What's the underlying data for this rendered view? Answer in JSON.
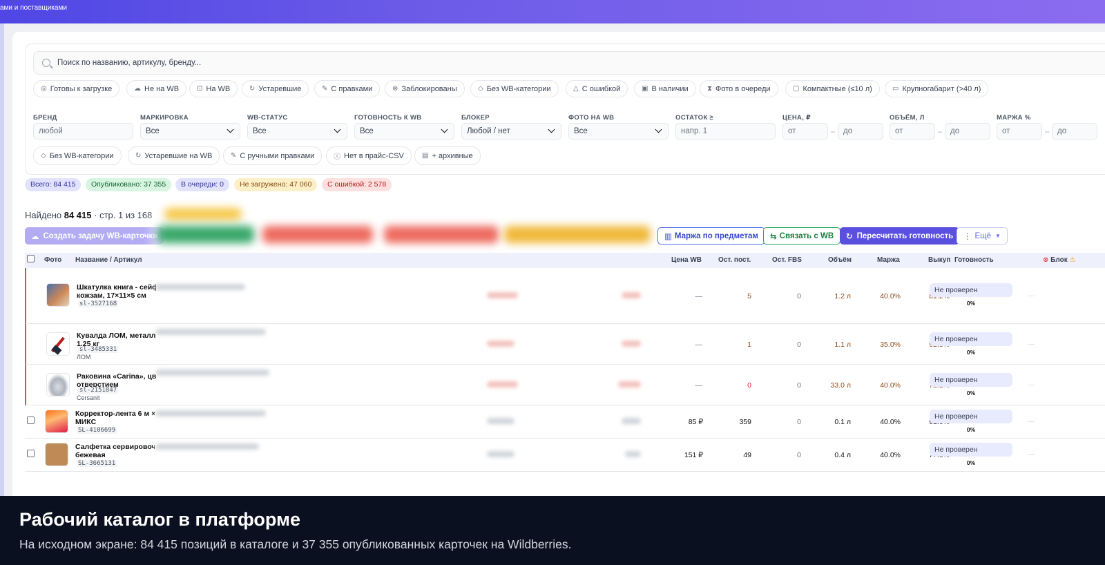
{
  "header": {
    "title_fragment": "ами и поставщиками"
  },
  "search": {
    "placeholder": "Поиск по названию, артикулу, бренду..."
  },
  "quick_filters": [
    {
      "label": "Готовы к загрузке",
      "icon": "check-circle-icon"
    },
    {
      "label": "Не на WB",
      "icon": "cloud-icon"
    },
    {
      "label": "На WB",
      "icon": "bag-icon"
    },
    {
      "label": "Устаревшие",
      "icon": "refresh-icon"
    },
    {
      "label": "С правками",
      "icon": "pin-icon"
    },
    {
      "label": "Заблокированы",
      "icon": "x-circle-icon"
    },
    {
      "label": "Без WB-категории",
      "icon": "tag-icon"
    },
    {
      "label": "С ошибкой",
      "icon": "warning-icon"
    },
    {
      "label": "В наличии",
      "icon": "box-icon"
    },
    {
      "label": "Фото в очереди",
      "icon": "hourglass-icon"
    },
    {
      "label": "Компактные (≤10 л)",
      "icon": "cube-icon"
    },
    {
      "label": "Крупногабарит (>40 л)",
      "icon": "package-icon"
    }
  ],
  "fields": {
    "brand": {
      "label": "БРЕНД",
      "placeholder": "любой"
    },
    "marking": {
      "label": "МАРКИРОВКА",
      "value": "Все"
    },
    "wb_status": {
      "label": "WB-СТАТУС",
      "value": "Все"
    },
    "readiness": {
      "label": "ГОТОВНОСТЬ К WB",
      "value": "Все"
    },
    "blocker": {
      "label": "БЛОКЕР",
      "value": "Любой / нет"
    },
    "photo": {
      "label": "ФОТО НА WB",
      "value": "Все"
    },
    "stock": {
      "label": "ОСТАТОК ≥",
      "placeholder": "напр. 1"
    },
    "price": {
      "label": "ЦЕНА, ₽",
      "from": "от",
      "to": "до"
    },
    "volume": {
      "label": "ОБЪЁМ, Л",
      "from": "от",
      "to": "до"
    },
    "margin": {
      "label": "МАРЖА %",
      "from": "от",
      "to": "до"
    }
  },
  "toggle_filters": [
    {
      "label": "Без WB-категории",
      "icon": "tag-icon"
    },
    {
      "label": "Устаревшие на WB",
      "icon": "refresh-icon"
    },
    {
      "label": "С ручными правками",
      "icon": "pin-icon"
    },
    {
      "label": "Нет в прайс-CSV",
      "icon": "alert-circle-icon"
    },
    {
      "label": "+ архивные",
      "icon": "archive-icon"
    }
  ],
  "stats": {
    "total": "Всего: 84 415",
    "published": "Опубликовано: 37 355",
    "queued": "В очереди: 0",
    "not_loaded": "Не загружено: 47 060",
    "errors": "С ошибкой: 2 578"
  },
  "results": {
    "prefix": "Найдено",
    "count": "84 415",
    "suffix": "· стр. 1 из 168"
  },
  "actions": {
    "create_task": "Создать задачу WB-карточки",
    "margin_by_subject": "Маржа по предметам",
    "link_wb": "Связать с WB",
    "recalc": "Пересчитать готовность",
    "more": "Ещё"
  },
  "columns": [
    "Фото",
    "Название / Артикул",
    "Цена WB",
    "Ост. пост.",
    "Ост. FBS",
    "Объём",
    "Маржа",
    "Выкуп",
    "Готовность",
    "Блок"
  ],
  "rows": [
    {
      "name1": "Шкатулка книга - сейф",
      "name2": "кожзам, 17×11×5 см",
      "sku": "sl-3527168",
      "brand": "",
      "price": "—",
      "stock": "5",
      "fbs": "0",
      "volume": "1.2 л",
      "margin": "40.0%",
      "buyout": "81.2%",
      "readiness": "Не проверен",
      "pct": "0%",
      "block": "—",
      "error": true
    },
    {
      "name1": "Кувалда ЛОМ, металл",
      "name2": "1.25 кг",
      "sku": "sl-3485331",
      "brand": "ЛОМ",
      "price": "—",
      "stock": "1",
      "fbs": "0",
      "volume": "1.1 л",
      "margin": "35.0%",
      "buyout": "92.3%",
      "readiness": "Не проверен",
      "pct": "0%",
      "block": "—",
      "error": true
    },
    {
      "name1": "Раковина «Carina», цв",
      "name2": "отверстием",
      "sku": "sl-2151847",
      "brand": "Cersanit",
      "price": "—",
      "stock": "0",
      "fbs": "0",
      "volume": "33.0 л",
      "margin": "40.0%",
      "buyout": "72.1%",
      "readiness": "Не проверен",
      "pct": "0%",
      "block": "—",
      "error": true
    },
    {
      "name1": "Корректор-лента 6 м ×",
      "name2": "МИКС",
      "sku": "SL-4106699",
      "brand": "",
      "price": "85 ₽",
      "stock": "359",
      "fbs": "0",
      "volume": "0.1 л",
      "margin": "40.0%",
      "buyout": "91.0%",
      "readiness": "Не проверен",
      "pct": "0%",
      "block": "—",
      "error": false
    },
    {
      "name1": "Салфетка сервировоч",
      "name2": "бежевая",
      "sku": "SL-3665131",
      "brand": "",
      "price": "151 ₽",
      "stock": "49",
      "fbs": "0",
      "volume": "0.4 л",
      "margin": "40.0%",
      "buyout": "77.8%",
      "readiness": "Не проверен",
      "pct": "0%",
      "block": "—",
      "error": false
    }
  ],
  "caption": {
    "title": "Рабочий каталог в платформе",
    "subtitle": "На исходном экране: 84 415 позиций в каталоге и 37 355 опубликованных карточек на Wildberries."
  }
}
